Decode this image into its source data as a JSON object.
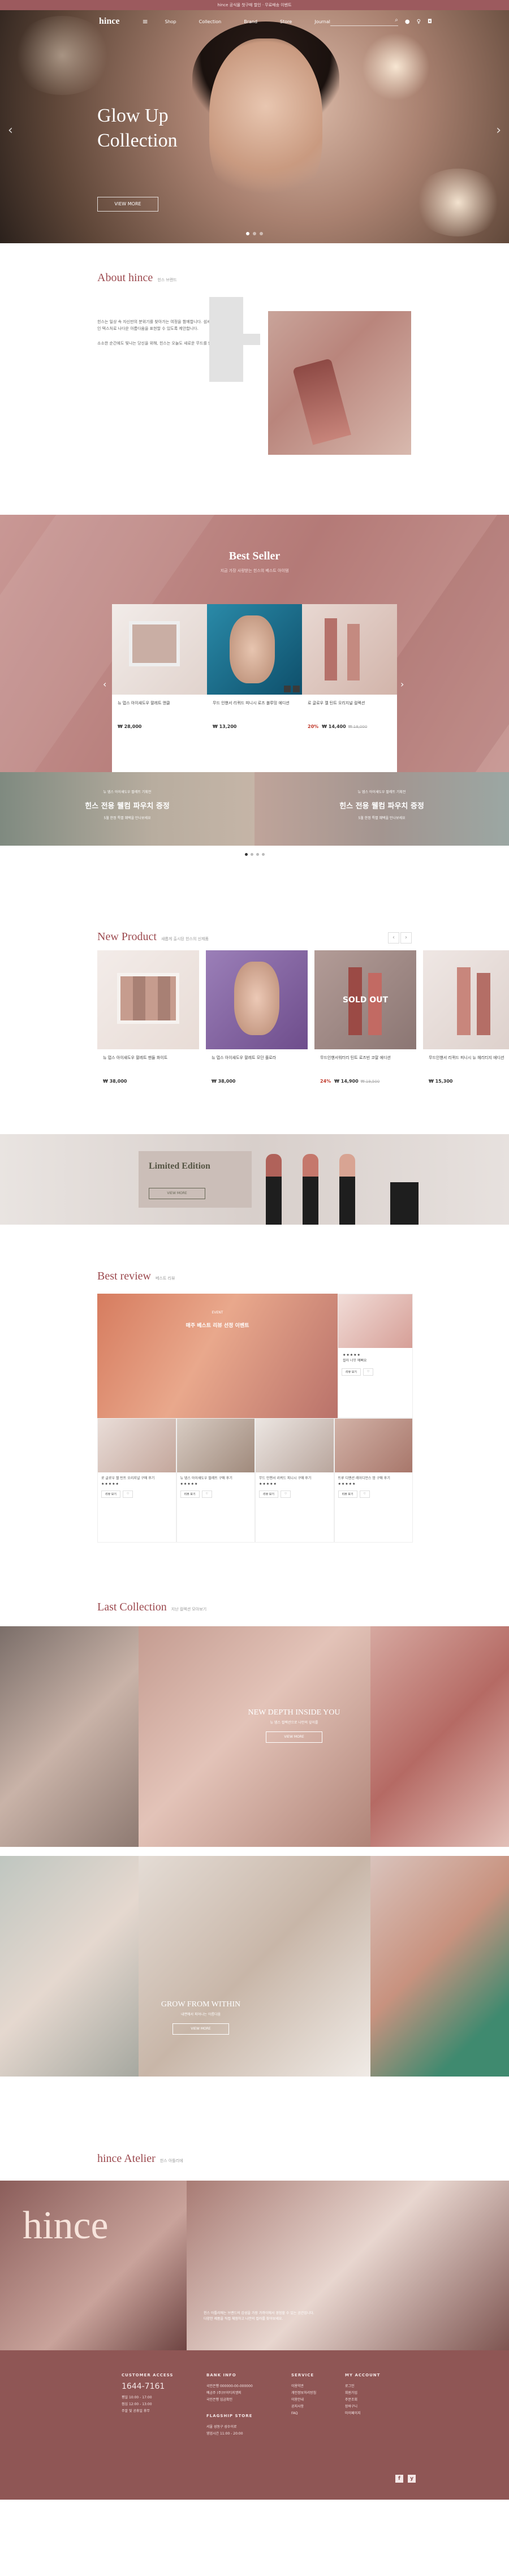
{
  "topbar": {
    "text": "hince 공식몰 첫구매 할인 · 무료배송 이벤트"
  },
  "nav": {
    "logo": "hince",
    "menu": [
      "Shop",
      "Collection",
      "Brand",
      "Store",
      "Journal"
    ],
    "search_placeholder": ""
  },
  "hero": {
    "title_line1": "Glow Up",
    "title_line2": "Collection",
    "button": "VIEW MORE"
  },
  "about": {
    "title": "About hince",
    "subtitle": "힌스 브랜드",
    "para1": "힌스는 일상 속 자신만의 분위기를 찾아가는 여정을 함께합니다. 섬세한 색감과 감각적인 텍스처로 나다운 아름다움을 표현할 수 있도록 제안합니다.",
    "para2": "소소한 순간에도 빛나는 당신을 위해, 힌스는 오늘도 새로운 무드를 만듭니다."
  },
  "best": {
    "title": "Best Seller",
    "subtitle": "지금 가장 사랑받는 힌스의 베스트 아이템",
    "items": [
      {
        "name": "뉴 뎁스 아이섀도우 팔레트 앤클",
        "price": "₩ 28,000"
      },
      {
        "name": "무드 인핸서 리퀴드 피니시 로즈 블루밍 에디션",
        "price": "₩ 13,200"
      },
      {
        "name": "로 글로우 젤 틴트 오리지널 컬렉션",
        "pct": "20%",
        "price": "₩ 14,400",
        "old": "₩ 18,000"
      }
    ]
  },
  "banners": [
    {
      "t1": "뉴 뎁스 아이섀도우 팔레트 기획전",
      "t2": "힌스 전용 웰컴 파우치 증정",
      "t3": "5월 한정 특별 혜택을 만나보세요"
    },
    {
      "t1": "뉴 뎁스 아이섀도우 팔레트 기획전",
      "t2": "힌스 전용 웰컴 파우치 증정",
      "t3": "5월 한정 특별 혜택을 만나보세요"
    }
  ],
  "newp": {
    "title": "New Product",
    "subtitle": "새롭게 출시된 힌스의 신제품",
    "sold_out": "SOLD OUT",
    "items": [
      {
        "name": "뉴 뎁스 아이섀도우 팔레트 맨들 화이트",
        "price": "₩ 38,000"
      },
      {
        "name": "뉴 뎁스 아이섀도우 팔레트 모던 플로라",
        "price": "₩ 38,000"
      },
      {
        "name": "무드인핸서워터리 틴트 로즈빈 코랄 에디션",
        "pct": "24%",
        "price": "₩ 14,900",
        "old": "₩ 19,500"
      },
      {
        "name": "무드인핸서 리퀴드 피니시 뉴 헤리티지 에디션",
        "price": "₩ 15,300"
      }
    ]
  },
  "limited": {
    "title": "Limited Edition",
    "button": "VIEW MORE"
  },
  "review": {
    "title": "Best review",
    "subtitle": "베스트 리뷰",
    "event_label": "EVENT",
    "event_title": "매주 베스트 리뷰 선정 이벤트",
    "items": [
      {
        "title": "로 글로우 젤 틴트 오리지널 구매 후기",
        "stars": "★★★★★"
      },
      {
        "title": "뉴 뎁스 아이섀도우 팔레트 구매 후기",
        "stars": "★★★★★"
      },
      {
        "title": "무드 인핸서 리퀴드 피니시 구매 후기",
        "stars": "★★★★★"
      },
      {
        "title": "트루 디멘션 레이디언스 밤 구매 후기",
        "stars": "★★★★★"
      }
    ],
    "side": {
      "title": "컬러 너무 예뻐요",
      "stars": "★★★★★"
    },
    "btn_view": "리뷰 보기",
    "btn_like": "♡"
  },
  "last": {
    "title": "Last Collection",
    "subtitle": "지난 컬렉션 모아보기",
    "c1": {
      "h": "NEW DEPTH INSIDE YOU",
      "s": "뉴 뎁스 컬렉션으로 나만의 깊이를",
      "b": "VIEW MORE"
    },
    "c2": {
      "h": "GROW FROM WITHIN",
      "s": "내면에서 피어나는 아름다움",
      "b": "VIEW MORE"
    }
  },
  "atelier": {
    "title": "hince Atelier",
    "subtitle": "힌스 아틀리에",
    "sign": "hince",
    "text": "힌스 아틀리에는 브랜드의 감성을 가장 가까이에서 경험할 수 있는 공간입니다. 다양한 제품을 직접 체험하고 나만의 컬러를 찾아보세요."
  },
  "footer": {
    "cs_title": "CUSTOMER ACCESS",
    "tel": "1644-7161",
    "cs_lines": [
      "평일 10:00 - 17:00",
      "점심 12:00 - 13:00",
      "주말 및 공휴일 휴무"
    ],
    "bank_title": "BANK INFO",
    "bank_lines": [
      "국민은행 000000-00-000000",
      "예금주 (주)브이티지엠피",
      "국민은행 입금확인"
    ],
    "ship_title": "FLAGSHIP STORE",
    "ship_lines": [
      "서울 성동구 성수이로",
      "영업시간 11:00 - 20:00"
    ],
    "service_title": "SERVICE",
    "service_lines": [
      "이용약관",
      "개인정보처리방침",
      "이용안내",
      "공지사항",
      "FAQ"
    ],
    "account_title": "MY ACCOUNT",
    "account_lines": [
      "로그인",
      "회원가입",
      "주문조회",
      "장바구니",
      "마이페이지"
    ],
    "sns": [
      "f",
      "y"
    ]
  },
  "colors": {
    "brand": "#9c5a5e",
    "footer": "#8f5655",
    "accent_text": "#9c4a4f"
  }
}
